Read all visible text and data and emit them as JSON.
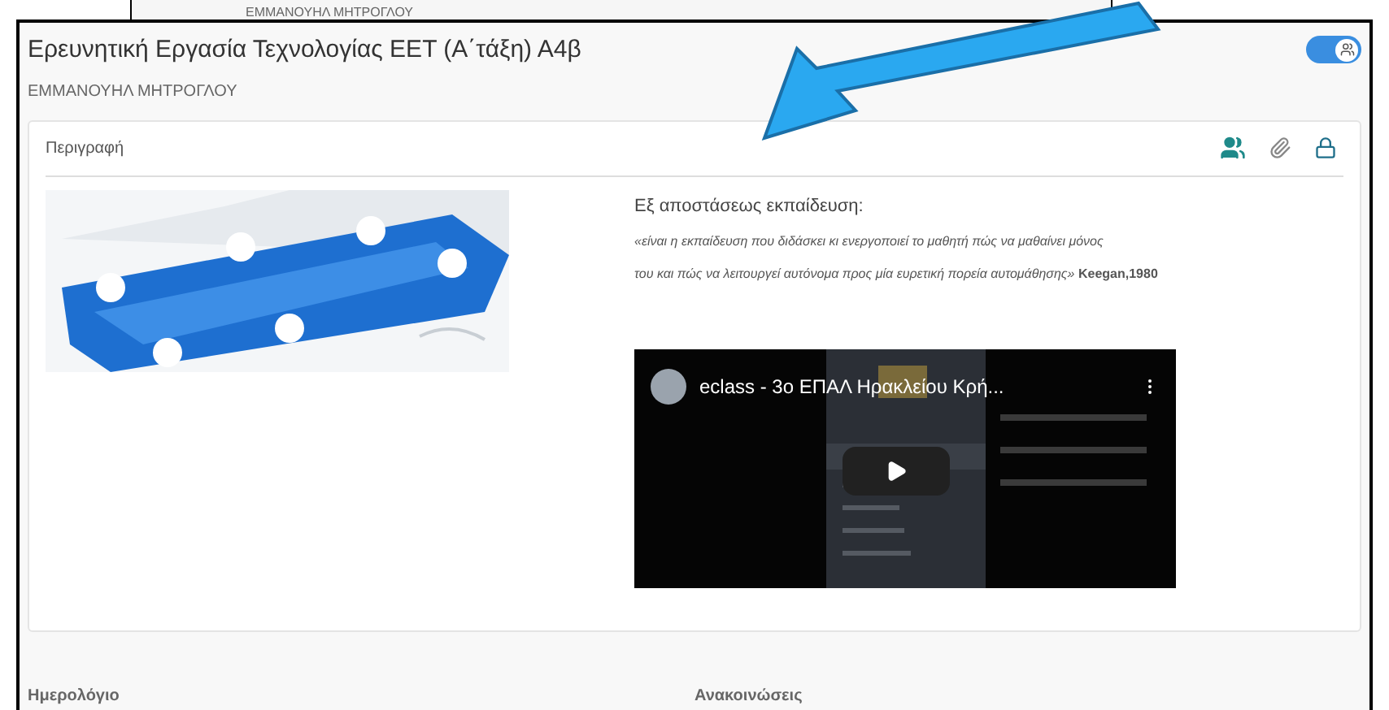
{
  "top_strip": {
    "text": "ΕΜΜΑΝΟΥΗΛ ΜΗΤΡΟΓΛΟΥ"
  },
  "course": {
    "title": "Ερευνητική Εργασία Τεχνολογίας ΕΕΤ (Α΄τάξη) Α4β",
    "teacher": "ΕΜΜΑΝΟΥΗΛ ΜΗΤΡΟΓΛΟΥ",
    "toggle": {
      "on": true
    }
  },
  "description": {
    "heading": "Περιγραφή",
    "subtitle": "Εξ αποστάσεως εκπαίδευση:",
    "quote_lines": [
      "«είναι η εκπαίδευση που διδάσκει κι ενεργοποιεί το μαθητή πώς να μαθαίνει μόνος",
      "*του και πώς να λειτουργεί αυτόνομα προς μία ευρετική πορεία αυτομάθησης»* **Keegan,1980**"
    ],
    "video": {
      "title": "eclass - 3ο ΕΠΑΛ Ηρακλείου Κρή..."
    }
  },
  "sections": [
    {
      "heading": "Ημερολόγιο"
    },
    {
      "heading": "Ανακοινώσεις"
    }
  ]
}
